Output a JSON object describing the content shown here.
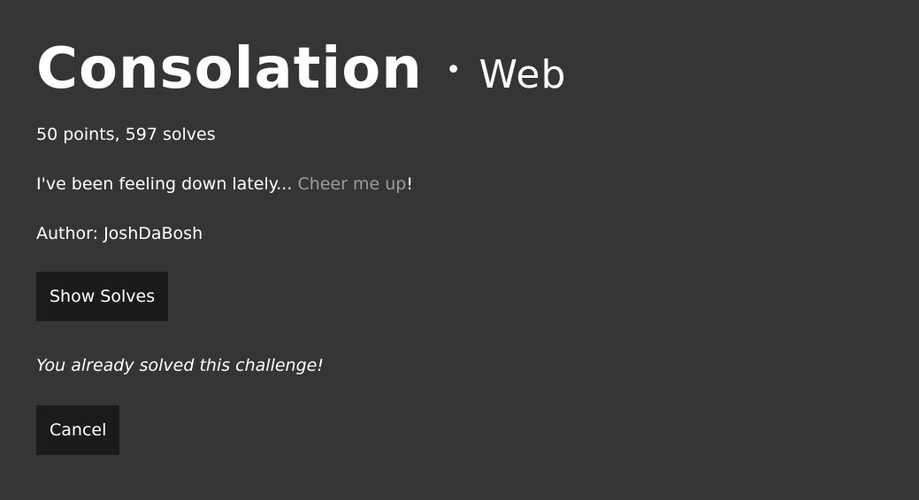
{
  "challenge": {
    "title": "Consolation",
    "separator": "•",
    "category": "Web",
    "points_line": "50 points, 597 solves",
    "description_prefix": "I've been feeling down lately... ",
    "description_link": "Cheer me up",
    "description_suffix": "!",
    "author_line": "Author: JoshDaBosh"
  },
  "actions": {
    "show_solves_label": "Show Solves",
    "solved_message": "You already solved this challenge!",
    "cancel_label": "Cancel"
  }
}
